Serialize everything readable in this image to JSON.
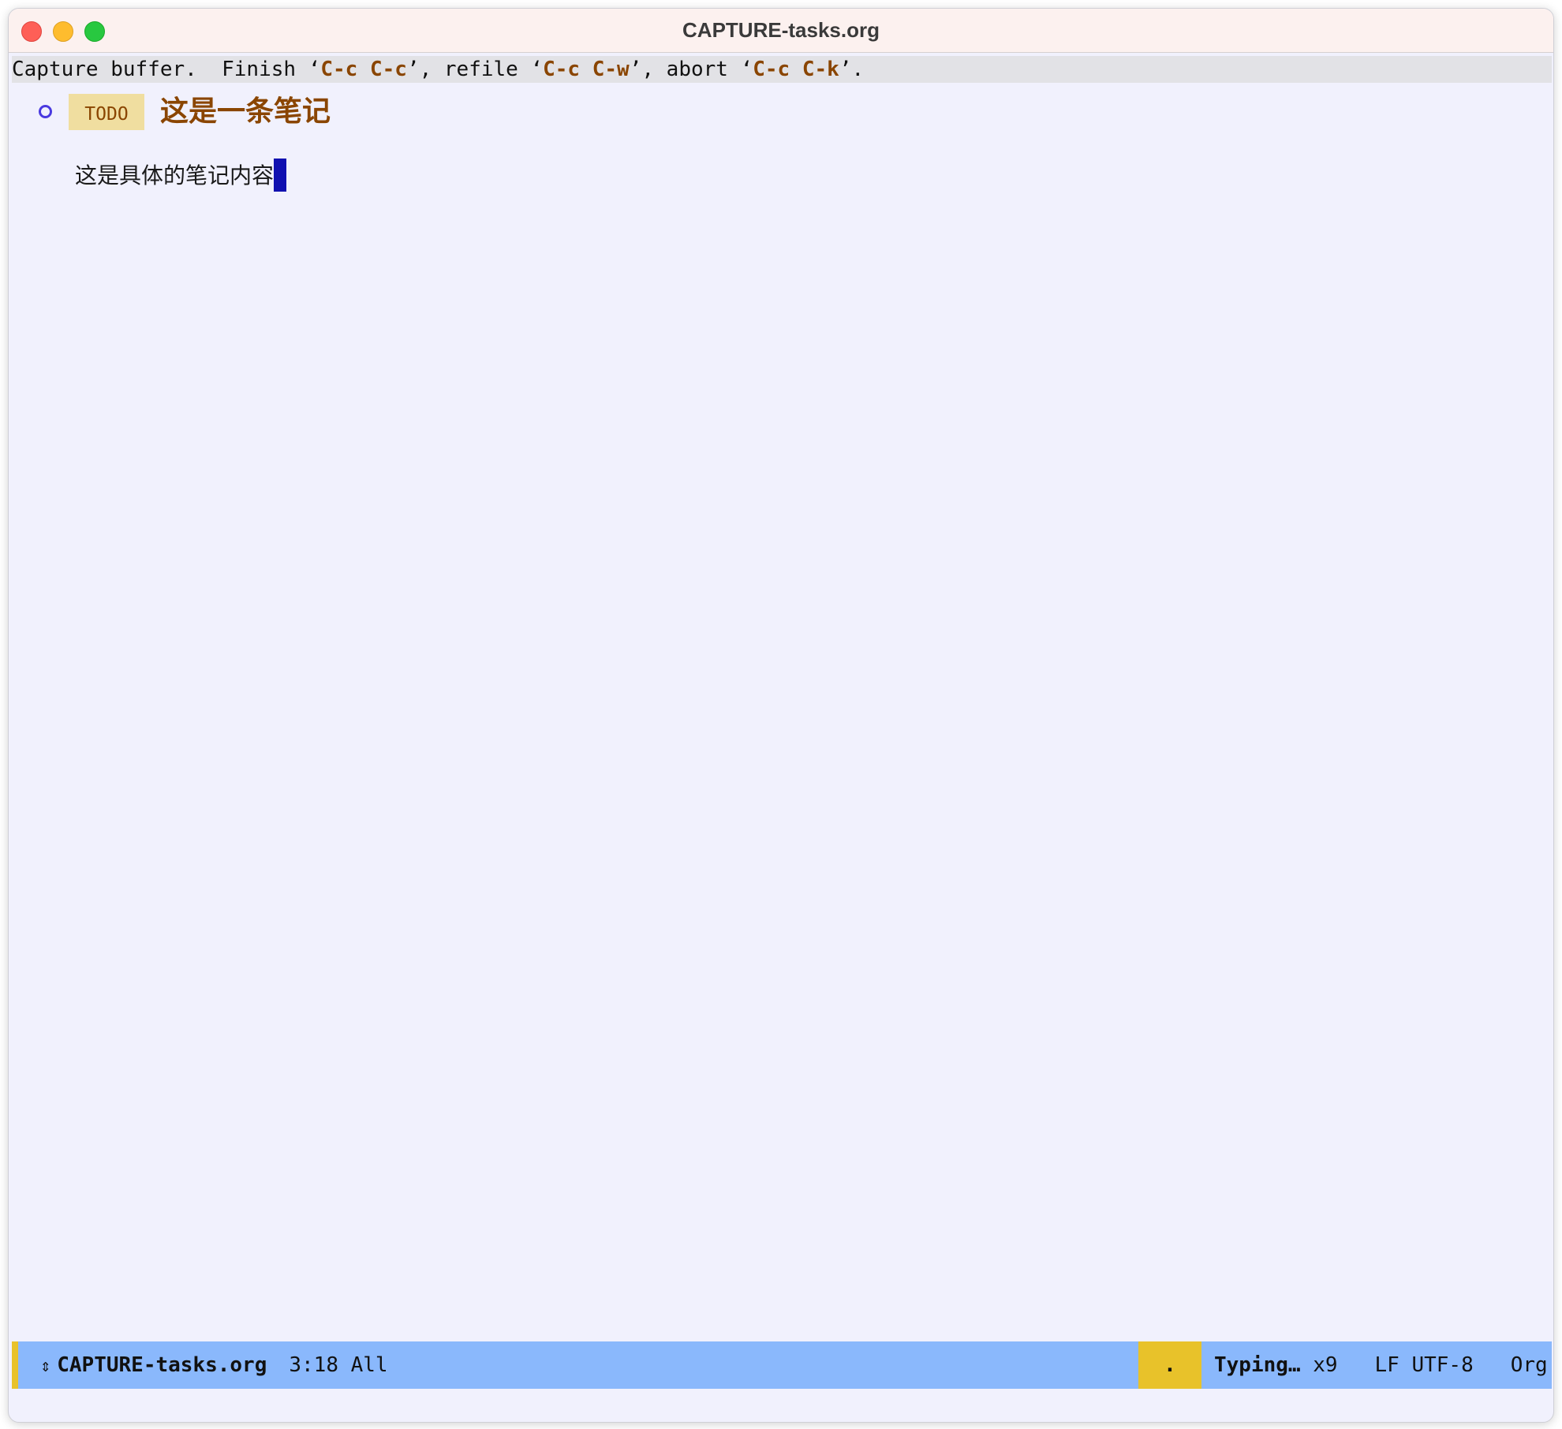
{
  "window": {
    "title": "CAPTURE-tasks.org"
  },
  "header_line": {
    "prefix": "Capture buffer.  Finish ",
    "finish_key": "C-c C-c",
    "refile_text": ", refile ",
    "refile_key": "C-c C-w",
    "abort_text": ", abort ",
    "abort_key": "C-c C-k",
    "suffix": ".",
    "quote_open": "‘",
    "quote_close": "’"
  },
  "editor": {
    "heading": {
      "keyword": "TODO",
      "text": "这是一条笔记"
    },
    "body": "这是具体的笔记内容"
  },
  "mode_line": {
    "arrow": "⇕",
    "buffer_name": "CAPTURE-tasks.org",
    "position": "3:18 All",
    "indicator": ".",
    "typing": "Typing…",
    "typing_count": "x9",
    "encoding": "LF UTF-8",
    "major_mode": "Org"
  },
  "colors": {
    "background": "#f1f1fd",
    "title_bar": "#fcf1ef",
    "key_color": "#8a4500",
    "todo_bg": "#f0dea0",
    "cursor": "#1010b0",
    "mode_line": "#8ab8fc",
    "mode_line_accent": "#e8c22a"
  }
}
